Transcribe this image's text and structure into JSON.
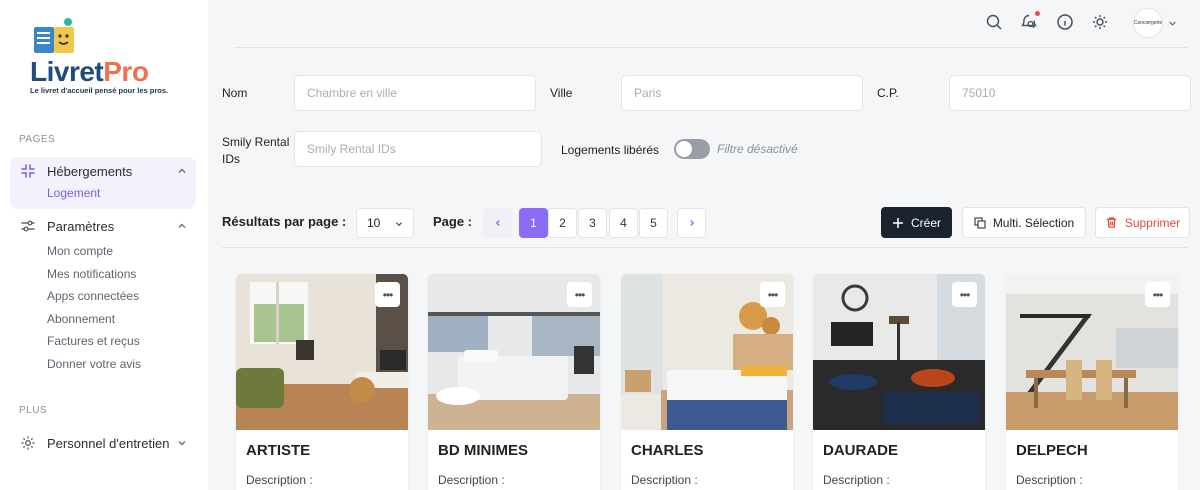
{
  "brand": {
    "name_part1": "Livret",
    "name_part2": "Pro",
    "tagline": "Le livret d'accueil pensé pour les pros."
  },
  "sidebar": {
    "section_pages": "PAGES",
    "section_plus": "PLUS",
    "groups": [
      {
        "label": "Hébergements",
        "icon": "shrink-icon",
        "items": [
          "Logement"
        ]
      },
      {
        "label": "Paramètres",
        "icon": "sliders-icon",
        "items": [
          "Mon compte",
          "Mes notifications",
          "Apps connectées",
          "Abonnement",
          "Factures et reçus",
          "Donner votre avis"
        ]
      },
      {
        "label": "Personnel d'entretien",
        "icon": "gear-icon",
        "items": []
      }
    ]
  },
  "topbar": {
    "avatar_text": "Conciergerie"
  },
  "filters": {
    "name_label": "Nom",
    "name_placeholder": "Chambre en ville",
    "city_label": "Ville",
    "city_placeholder": "Paris",
    "zip_label": "C.P.",
    "zip_placeholder": "75010",
    "smily_label_1": "Smily Rental",
    "smily_label_2": "IDs",
    "smily_placeholder": "Smily Rental IDs",
    "freed_label": "Logements libérés",
    "freed_state": "Filtre désactivé"
  },
  "pagination": {
    "per_page_label": "Résultats par page :",
    "per_page_value": "10",
    "page_label": "Page :",
    "pages": [
      "1",
      "2",
      "3",
      "4",
      "5"
    ],
    "current": "1"
  },
  "actions": {
    "create": "Créer",
    "multi": "Multi. Sélection",
    "delete": "Supprimer"
  },
  "cards": [
    {
      "title": "ARTISTE",
      "desc": "Description :"
    },
    {
      "title": "BD MINIMES",
      "desc": "Description :"
    },
    {
      "title": "CHARLES",
      "desc": "Description :"
    },
    {
      "title": "DAURADE",
      "desc": "Description :"
    },
    {
      "title": "DELPECH",
      "desc": "Description :"
    }
  ],
  "colors": {
    "accent": "#8b6cf5",
    "dark": "#1b2230",
    "danger": "#e24a3a"
  }
}
